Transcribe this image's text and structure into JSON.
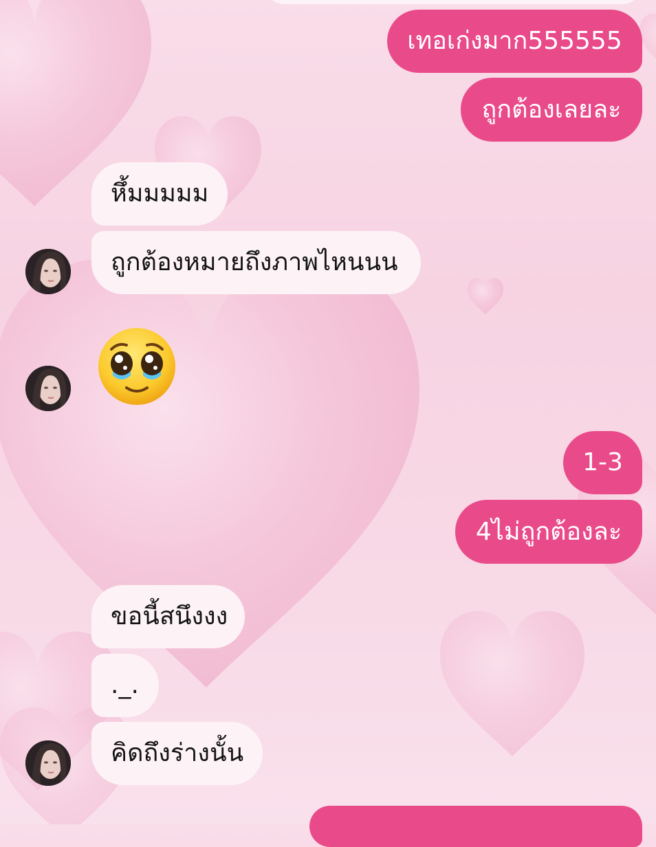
{
  "colors": {
    "outgoing_bubble": "#e94b8a",
    "incoming_bubble": "#fdf3f6",
    "background": "#f8d7e4"
  },
  "messages": {
    "out_1": "เทอเก่งมาก555555",
    "out_2": "ถูกต้องเลยละ",
    "in_1": "หึ้มมมมม",
    "in_2": "ถูกต้องหมายถึงภาพไหนนน",
    "in_emoji_name": "pleading-face-with-tears",
    "out_3": "1-3",
    "out_4": "4ไม่ถูกต้องละ",
    "in_3": "ขอนี้สนึงงง",
    "in_4": "._.",
    "in_5": "คิดถึงร่างนั้น"
  }
}
